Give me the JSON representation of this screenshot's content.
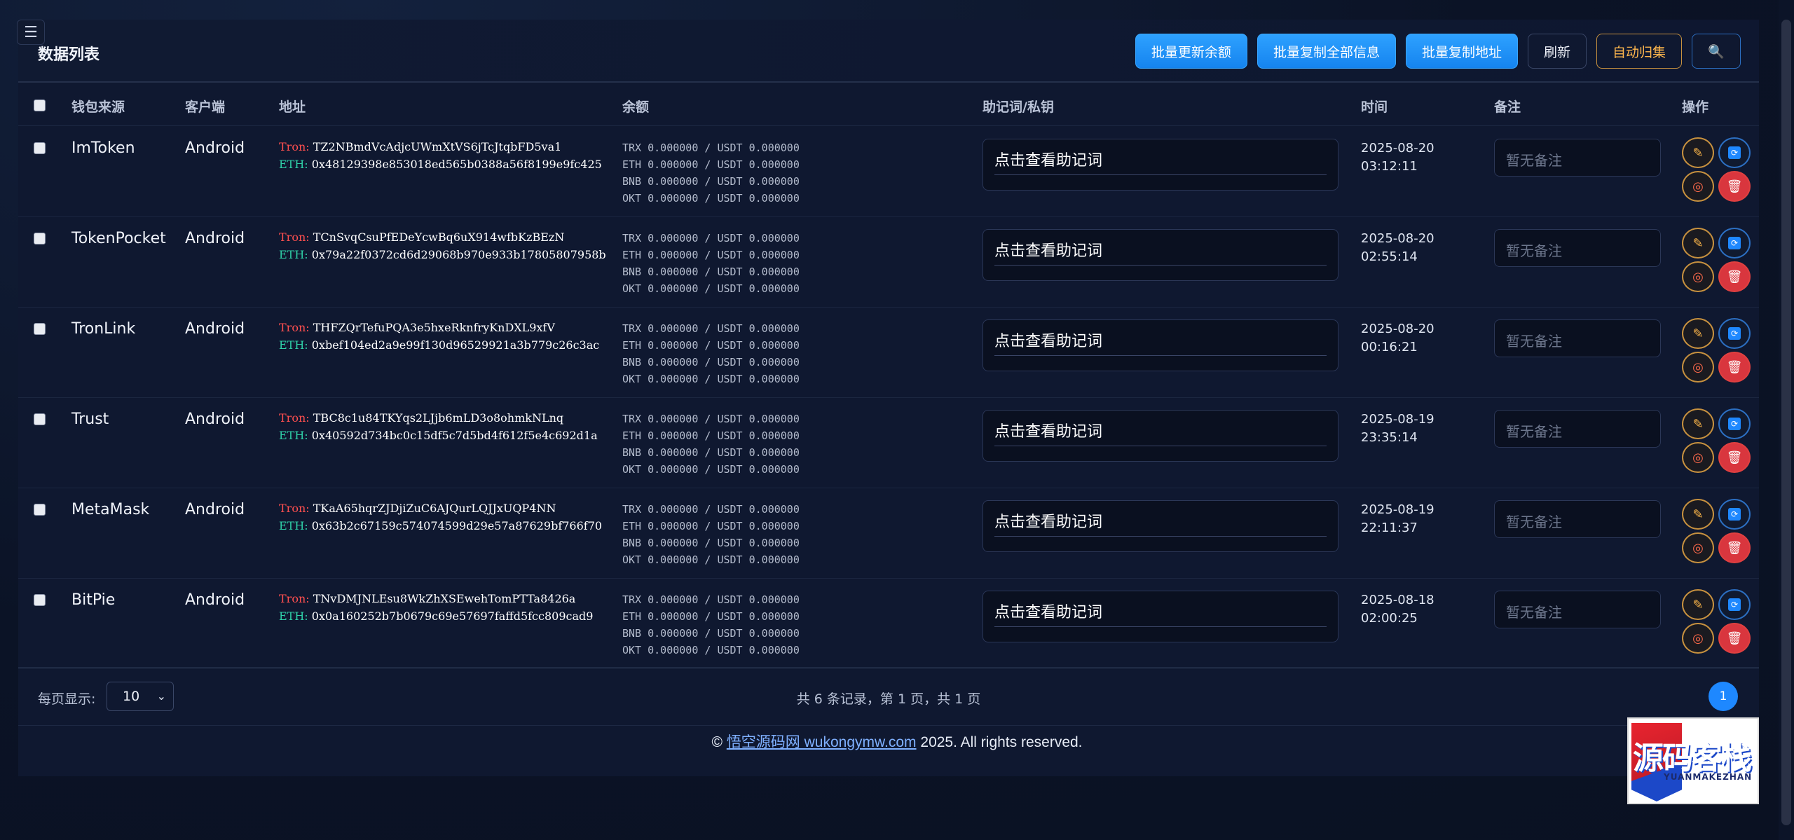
{
  "menu_icon": "menu-icon",
  "header": {
    "title": "数据列表",
    "buttons": {
      "batch_update_balance": "批量更新余额",
      "batch_copy_all": "批量复制全部信息",
      "batch_copy_address": "批量复制地址",
      "refresh": "刷新",
      "auto_collect": "自动归集",
      "search_icon": "🔍"
    }
  },
  "table": {
    "columns": [
      "钱包来源",
      "客户端",
      "地址",
      "余额",
      "助记词/私钥",
      "时间",
      "备注",
      "操作"
    ],
    "labels": {
      "tron": "Tron:",
      "eth": "ETH:",
      "mnemonic_btn": "点击查看助记词",
      "note_placeholder": "暂无备注"
    },
    "balances": [
      "TRX 0.000000 / USDT 0.000000",
      "ETH 0.000000 / USDT 0.000000",
      "BNB 0.000000 / USDT 0.000000",
      "OKT 0.000000 / USDT 0.000000"
    ],
    "rows": [
      {
        "source": "ImToken",
        "client": "Android",
        "tron": "TZ2NBmdVcAdjcUWmXtVS6jTcJtqbFD5va1",
        "eth": "0x48129398e853018ed565b0388a56f8199e9fc425",
        "date": "2025-08-20",
        "time": "03:12:11"
      },
      {
        "source": "TokenPocket",
        "client": "Android",
        "tron": "TCnSvqCsuPfEDeYcwBq6uX914wfbKzBEzN",
        "eth": "0x79a22f0372cd6d29068b970e933b17805807958b",
        "date": "2025-08-20",
        "time": "02:55:14"
      },
      {
        "source": "TronLink",
        "client": "Android",
        "tron": "THFZQrTefuPQA3e5hxeRknfryKnDXL9xfV",
        "eth": "0xbef104ed2a9e99f130d96529921a3b779c26c3ac",
        "date": "2025-08-20",
        "time": "00:16:21"
      },
      {
        "source": "Trust",
        "client": "Android",
        "tron": "TBC8c1u84TKYqs2LJjb6mLD3o8ohmkNLnq",
        "eth": "0x40592d734bc0c15df5c7d5bd4f612f5e4c692d1a",
        "date": "2025-08-19",
        "time": "23:35:14"
      },
      {
        "source": "MetaMask",
        "client": "Android",
        "tron": "TKaA65hqrZJDjiZuC6AJQurLQJJxUQP4NN",
        "eth": "0x63b2c67159c574074599d29e57a87629bf766f70",
        "date": "2025-08-19",
        "time": "22:11:37"
      },
      {
        "source": "BitPie",
        "client": "Android",
        "tron": "TNvDMJNLEsu8WkZhXSEwehTomPTTa8426a",
        "eth": "0x0a160252b7b0679c69e57697faffd5fcc809cad9",
        "date": "2025-08-18",
        "time": "02:00:25"
      }
    ]
  },
  "pagination": {
    "per_page_label": "每页显示:",
    "per_page_value": "10",
    "summary": "共 6 条记录，第 1 页，共 1 页",
    "current_page": "1"
  },
  "footer": {
    "copyright_symbol": "©",
    "link_text": "悟空源码网 wukongymw.com",
    "suffix": "2025. All rights reserved."
  },
  "watermark": {
    "text": "源码客栈",
    "sub": "YUANMAKEZHAN"
  }
}
